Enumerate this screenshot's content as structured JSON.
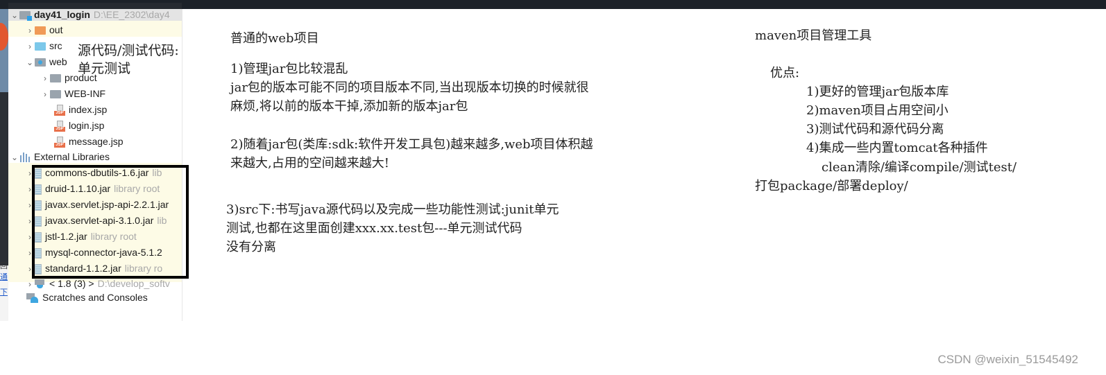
{
  "project_tree": {
    "root": {
      "name": "day41_login",
      "path": "D:\\EE_2302\\day4"
    },
    "items": [
      {
        "label": "out",
        "icon": "folder-orange-icon",
        "expanded": false
      },
      {
        "label": "src",
        "icon": "folder-blue-icon",
        "expanded": false
      },
      {
        "label": "web",
        "icon": "web-folder-icon",
        "expanded": true
      },
      {
        "label": "product",
        "icon": "folder-icon",
        "expanded": false
      },
      {
        "label": "WEB-INF",
        "icon": "folder-icon",
        "expanded": false
      },
      {
        "label": "index.jsp",
        "icon": "jsp-file-icon"
      },
      {
        "label": "login.jsp",
        "icon": "jsp-file-icon"
      },
      {
        "label": "message.jsp",
        "icon": "jsp-file-icon"
      }
    ],
    "external_libraries": {
      "label": "External Libraries",
      "jars": [
        {
          "name": "commons-dbutils-1.6.jar",
          "hint": "lib"
        },
        {
          "name": "druid-1.1.10.jar",
          "hint": "library root"
        },
        {
          "name": "javax.servlet.jsp-api-2.2.1.jar",
          "hint": ""
        },
        {
          "name": "javax.servlet-api-3.1.0.jar",
          "hint": "lib"
        },
        {
          "name": "jstl-1.2.jar",
          "hint": "library root"
        },
        {
          "name": "mysql-connector-java-5.1.2",
          "hint": ""
        },
        {
          "name": "standard-1.1.2.jar",
          "hint": "library ro"
        }
      ],
      "sdk": {
        "name": "< 1.8 (3) >",
        "path": "D:\\develop_softv"
      }
    },
    "scratches": "Scratches and Consoles"
  },
  "tree_annotation": {
    "line1": "源代码/测试代码:",
    "line2": "单元测试"
  },
  "left_strip_glyphs": [
    "回",
    "通",
    "下"
  ],
  "web_project_notes": {
    "title": "普通的web项目",
    "point1": {
      "heading": "1)管理jar包比较混乱",
      "line1": "jar包的版本可能不同的项目版本不同,当出现版本切换的时候就很",
      "line2": "麻烦,将以前的版本干掉,添加新的版本jar包"
    },
    "point2": {
      "line1": "2)随着jar包(类库:sdk:软件开发工具包)越来越多,web项目体积越",
      "line2": "来越大,占用的空间越来越大!"
    },
    "point3": {
      "line1": " 3)src下:书写java源代码以及完成一些功能性测试:junit单元",
      "line2": "测试,也都在这里面创建xxx.xx.test包---单元测试代码",
      "line3": "没有分离"
    }
  },
  "maven_notes": {
    "title": "maven项目管理工具",
    "advantages_label": "优点:",
    "advantages": [
      "1)更好的管理jar包版本库",
      "2)maven项目占用空间小",
      "3)测试代码和源代码分离",
      "4)集成一些内置tomcat各种插件"
    ],
    "plugins_line1": "clean清除/编译compile/测试test/",
    "plugins_line2": "打包package/部署deploy/"
  },
  "watermark": "CSDN @weixin_51545492"
}
